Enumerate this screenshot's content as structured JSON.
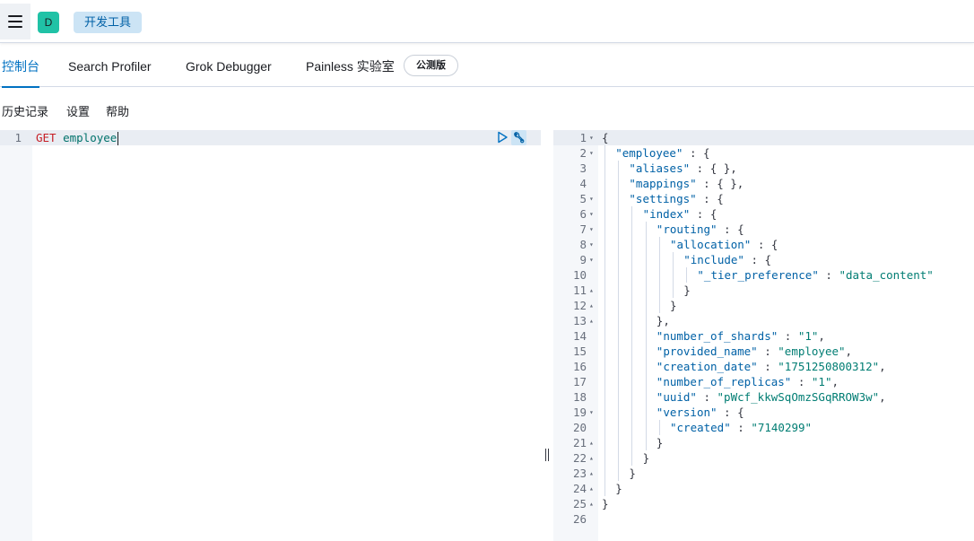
{
  "header": {
    "space_initial": "D",
    "breadcrumb": "开发工具"
  },
  "tabs": [
    {
      "label": "控制台",
      "active": true
    },
    {
      "label": "Search Profiler",
      "active": false
    },
    {
      "label": "Grok Debugger",
      "active": false
    },
    {
      "label": "Painless 实验室",
      "active": false
    }
  ],
  "beta_badge": "公测版",
  "submenu": {
    "history": "历史记录",
    "settings": "设置",
    "help": "帮助"
  },
  "request": {
    "line_number": "1",
    "method": "GET",
    "url": "employee"
  },
  "response_lines": [
    {
      "n": "1",
      "fold": "▾",
      "indent": 0,
      "tokens": [
        [
          "p",
          "{"
        ]
      ]
    },
    {
      "n": "2",
      "fold": "▾",
      "indent": 1,
      "tokens": [
        [
          "k",
          "\"employee\""
        ],
        [
          "p",
          " : {"
        ]
      ]
    },
    {
      "n": "3",
      "fold": "",
      "indent": 2,
      "tokens": [
        [
          "k",
          "\"aliases\""
        ],
        [
          "p",
          " : { },"
        ]
      ]
    },
    {
      "n": "4",
      "fold": "",
      "indent": 2,
      "tokens": [
        [
          "k",
          "\"mappings\""
        ],
        [
          "p",
          " : { },"
        ]
      ]
    },
    {
      "n": "5",
      "fold": "▾",
      "indent": 2,
      "tokens": [
        [
          "k",
          "\"settings\""
        ],
        [
          "p",
          " : {"
        ]
      ]
    },
    {
      "n": "6",
      "fold": "▾",
      "indent": 3,
      "tokens": [
        [
          "k",
          "\"index\""
        ],
        [
          "p",
          " : {"
        ]
      ]
    },
    {
      "n": "7",
      "fold": "▾",
      "indent": 4,
      "tokens": [
        [
          "k",
          "\"routing\""
        ],
        [
          "p",
          " : {"
        ]
      ]
    },
    {
      "n": "8",
      "fold": "▾",
      "indent": 5,
      "tokens": [
        [
          "k",
          "\"allocation\""
        ],
        [
          "p",
          " : {"
        ]
      ]
    },
    {
      "n": "9",
      "fold": "▾",
      "indent": 6,
      "tokens": [
        [
          "k",
          "\"include\""
        ],
        [
          "p",
          " : {"
        ]
      ]
    },
    {
      "n": "10",
      "fold": "",
      "indent": 7,
      "tokens": [
        [
          "k",
          "\"_tier_preference\""
        ],
        [
          "p",
          " : "
        ],
        [
          "s",
          "\"data_content\""
        ]
      ]
    },
    {
      "n": "11",
      "fold": "▴",
      "indent": 6,
      "tokens": [
        [
          "p",
          "}"
        ]
      ]
    },
    {
      "n": "12",
      "fold": "▴",
      "indent": 5,
      "tokens": [
        [
          "p",
          "}"
        ]
      ]
    },
    {
      "n": "13",
      "fold": "▴",
      "indent": 4,
      "tokens": [
        [
          "p",
          "},"
        ]
      ]
    },
    {
      "n": "14",
      "fold": "",
      "indent": 4,
      "tokens": [
        [
          "k",
          "\"number_of_shards\""
        ],
        [
          "p",
          " : "
        ],
        [
          "s",
          "\"1\""
        ],
        [
          "p",
          ","
        ]
      ]
    },
    {
      "n": "15",
      "fold": "",
      "indent": 4,
      "tokens": [
        [
          "k",
          "\"provided_name\""
        ],
        [
          "p",
          " : "
        ],
        [
          "s",
          "\"employee\""
        ],
        [
          "p",
          ","
        ]
      ]
    },
    {
      "n": "16",
      "fold": "",
      "indent": 4,
      "tokens": [
        [
          "k",
          "\"creation_date\""
        ],
        [
          "p",
          " : "
        ],
        [
          "s",
          "\"1751250800312\""
        ],
        [
          "p",
          ","
        ]
      ]
    },
    {
      "n": "17",
      "fold": "",
      "indent": 4,
      "tokens": [
        [
          "k",
          "\"number_of_replicas\""
        ],
        [
          "p",
          " : "
        ],
        [
          "s",
          "\"1\""
        ],
        [
          "p",
          ","
        ]
      ]
    },
    {
      "n": "18",
      "fold": "",
      "indent": 4,
      "tokens": [
        [
          "k",
          "\"uuid\""
        ],
        [
          "p",
          " : "
        ],
        [
          "s",
          "\"pWcf_kkwSqOmzSGqRROW3w\""
        ],
        [
          "p",
          ","
        ]
      ]
    },
    {
      "n": "19",
      "fold": "▾",
      "indent": 4,
      "tokens": [
        [
          "k",
          "\"version\""
        ],
        [
          "p",
          " : {"
        ]
      ]
    },
    {
      "n": "20",
      "fold": "",
      "indent": 5,
      "tokens": [
        [
          "k",
          "\"created\""
        ],
        [
          "p",
          " : "
        ],
        [
          "s",
          "\"7140299\""
        ]
      ]
    },
    {
      "n": "21",
      "fold": "▴",
      "indent": 4,
      "tokens": [
        [
          "p",
          "}"
        ]
      ]
    },
    {
      "n": "22",
      "fold": "▴",
      "indent": 3,
      "tokens": [
        [
          "p",
          "}"
        ]
      ]
    },
    {
      "n": "23",
      "fold": "▴",
      "indent": 2,
      "tokens": [
        [
          "p",
          "}"
        ]
      ]
    },
    {
      "n": "24",
      "fold": "▴",
      "indent": 1,
      "tokens": [
        [
          "p",
          "}"
        ]
      ]
    },
    {
      "n": "25",
      "fold": "▴",
      "indent": 0,
      "tokens": [
        [
          "p",
          "}"
        ]
      ]
    },
    {
      "n": "26",
      "fold": "",
      "indent": 0,
      "tokens": []
    }
  ],
  "colors": {
    "accent": "#0071c2",
    "method": "#c61e25",
    "json_key": "#0061a6",
    "json_string": "#017d73",
    "space_avatar": "#20c2a6"
  },
  "icons": {
    "menu": "hamburger-menu-icon",
    "run": "play-icon",
    "actions": "wrench-icon",
    "resizer": "resize-handle-icon"
  }
}
